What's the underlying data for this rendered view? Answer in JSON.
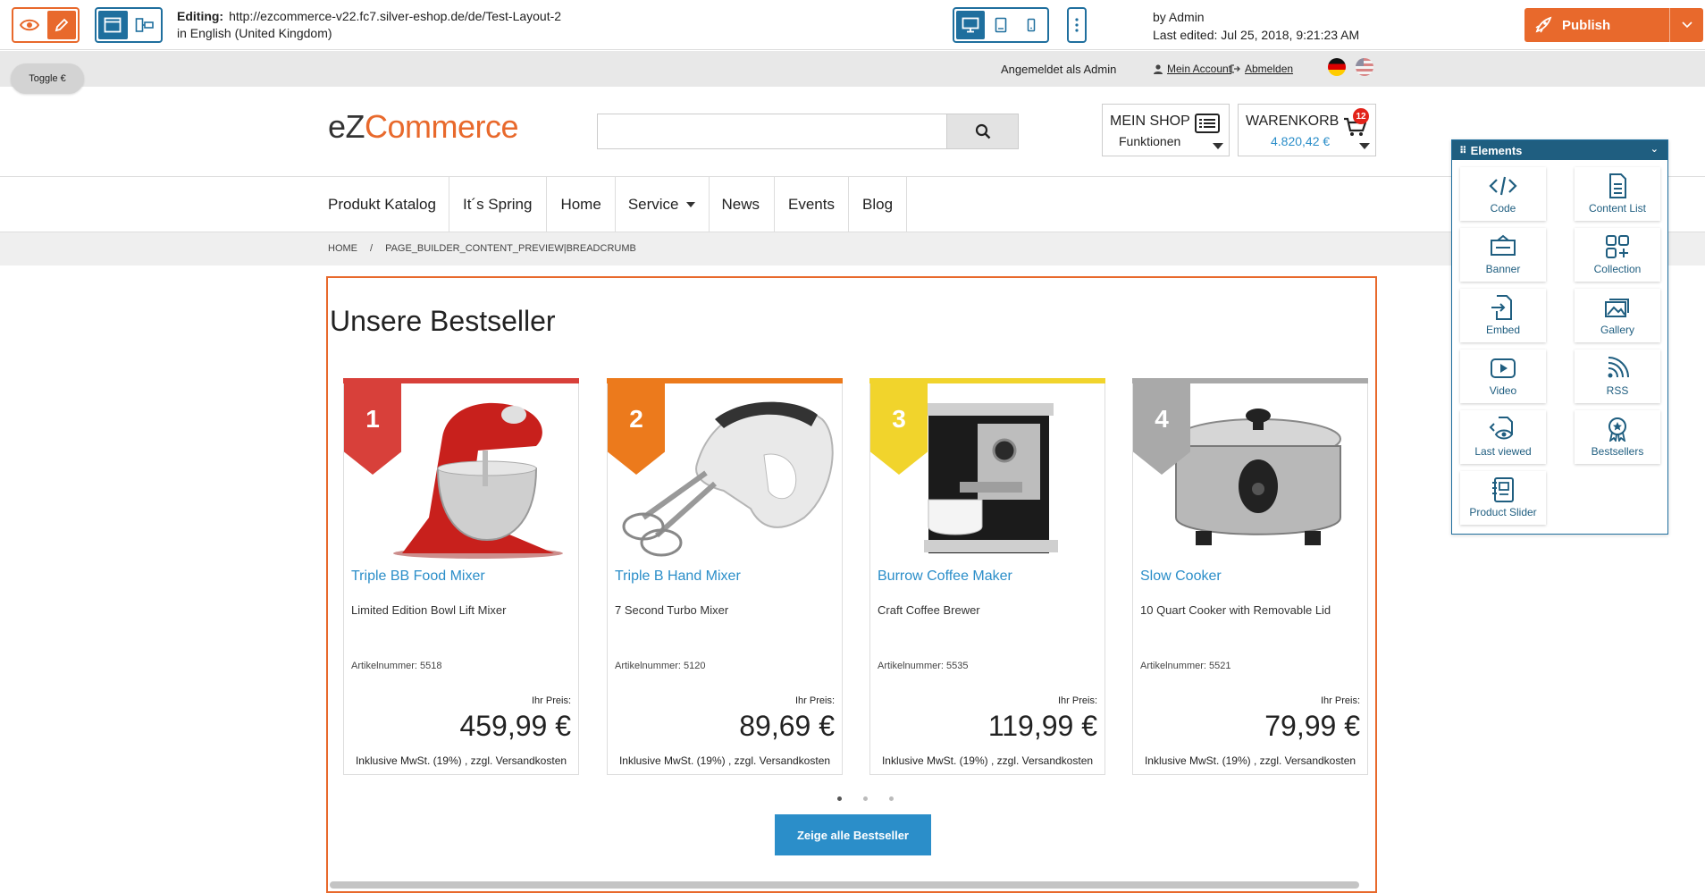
{
  "editor": {
    "editing_label": "Editing:",
    "url": "http://ezcommerce-v22.fc7.silver-eshop.de/de/Test-Layout-2",
    "language": "in English (United Kingdom)",
    "author": "by Admin",
    "last_edited": "Last edited: Jul 25, 2018, 9:21:23 AM",
    "publish_label": "Publish",
    "accent": "#e8692c",
    "primary": "#1f6f9e"
  },
  "toggle": {
    "label": "Toggle €"
  },
  "meta": {
    "login_text": "Angemeldet als Admin",
    "account_link": "Mein Account",
    "logout_link": "Abmelden"
  },
  "header": {
    "logo_ez": "eZ",
    "logo_commerce": "Commerce",
    "search_placeholder": "",
    "myshop_title": "MEIN SHOP",
    "myshop_sub": "Funktionen",
    "cart_title": "WARENKORB",
    "cart_total": "4.820,42 €",
    "cart_count": "12"
  },
  "nav": {
    "items": [
      "Produkt Katalog",
      "It´s Spring",
      "Home",
      "Service",
      "News",
      "Events",
      "Blog"
    ]
  },
  "breadcrumb": {
    "items": [
      "HOME",
      "/",
      "PAGE_BUILDER_CONTENT_PREVIEW|BREADCRUMB"
    ]
  },
  "bestseller": {
    "title": "Unsere Bestseller",
    "price_label": "Ihr Preis:",
    "tax_text": "Inklusive MwSt. (19%) , zzgl. Versandkosten",
    "sku_label": "Artikelnummer:",
    "show_all": "Zeige alle Bestseller",
    "products": [
      {
        "rank": "1",
        "name": "Triple BB Food Mixer",
        "desc": "Limited Edition Bowl Lift Mixer",
        "sku": "5518",
        "price": "459,99 €",
        "color": "#d8403a"
      },
      {
        "rank": "2",
        "name": "Triple B Hand Mixer",
        "desc": "7 Second Turbo Mixer",
        "sku": "5120",
        "price": "89,69 €",
        "color": "#ec7a1c"
      },
      {
        "rank": "3",
        "name": "Burrow Coffee Maker",
        "desc": "Craft Coffee Brewer",
        "sku": "5535",
        "price": "119,99 €",
        "color": "#f1d42c"
      },
      {
        "rank": "4",
        "name": "Slow Cooker",
        "desc": "10 Quart Cooker with Removable Lid",
        "sku": "5521",
        "price": "79,99 €",
        "color": "#a9a9a9"
      }
    ]
  },
  "elements_panel": {
    "title": "Elements",
    "items": [
      "Code",
      "Content List",
      "Banner",
      "Collection",
      "Embed",
      "Gallery",
      "Video",
      "RSS",
      "Last viewed",
      "Bestsellers",
      "Product Slider"
    ]
  }
}
